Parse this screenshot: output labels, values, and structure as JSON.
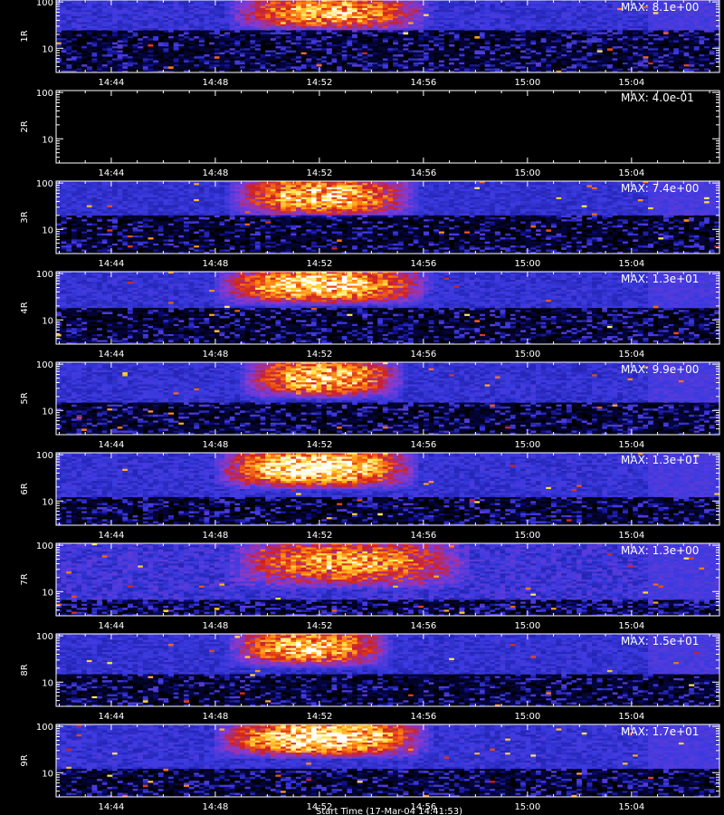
{
  "chart_data": {
    "type": "heatmap",
    "xlabel": "Start Time (17-Mar-04 14:41:53)",
    "x_ticks": [
      "14:44",
      "14:48",
      "14:52",
      "14:56",
      "15:00",
      "15:04"
    ],
    "x_tick_minutes_after_start": [
      2.12,
      6.12,
      10.12,
      14.12,
      18.12,
      22.12
    ],
    "x_range_minutes": [
      0,
      25.5
    ],
    "y_scale": "log",
    "y_ticks": [
      "100",
      "10"
    ],
    "y_tick_values": [
      100,
      10
    ],
    "y_range": [
      3,
      110
    ],
    "colormap": [
      "#000000",
      "#0a0a80",
      "#3a3ae0",
      "#8a3ad0",
      "#d02020",
      "#ff7a10",
      "#ffe040",
      "#ffffff"
    ],
    "panels": [
      {
        "label": "1R",
        "max_text": "MAX: 8.1e+00",
        "max": 8.1,
        "band": [
          40,
          90
        ],
        "burst": [
          6.5,
          14.5
        ],
        "burst_peak": 0.75,
        "threshold": 25,
        "noise": 0.55
      },
      {
        "label": "2R",
        "max_text": "MAX: 4.0e-01",
        "max": 0.4,
        "band": [
          40,
          90
        ],
        "burst": [
          6.5,
          14.5
        ],
        "burst_peak": 0,
        "threshold": 25,
        "noise": 0
      },
      {
        "label": "3R",
        "max_text": "MAX: 7.4e+00",
        "max": 7.4,
        "band": [
          30,
          90
        ],
        "burst": [
          6.5,
          14.0
        ],
        "burst_peak": 0.8,
        "threshold": 20,
        "noise": 0.45
      },
      {
        "label": "4R",
        "max_text": "MAX: 1.3e+01",
        "max": 13,
        "band": [
          35,
          95
        ],
        "burst": [
          6.0,
          14.5
        ],
        "burst_peak": 0.9,
        "threshold": 18,
        "noise": 0.5
      },
      {
        "label": "5R",
        "max_text": "MAX: 9.9e+00",
        "max": 9.9,
        "band": [
          30,
          95
        ],
        "burst": [
          7.0,
          13.5
        ],
        "burst_peak": 0.8,
        "threshold": 15,
        "noise": 0.5
      },
      {
        "label": "6R",
        "max_text": "MAX: 1.3e+01",
        "max": 13,
        "band": [
          30,
          95
        ],
        "burst": [
          6.0,
          14.0
        ],
        "burst_peak": 0.95,
        "threshold": 12,
        "noise": 0.55
      },
      {
        "label": "7R",
        "max_text": "MAX: 1.3e+00",
        "max": 1.3,
        "band": [
          20,
          90
        ],
        "burst": [
          6.5,
          16.0
        ],
        "burst_peak": 0.65,
        "threshold": 7,
        "noise": 0.75
      },
      {
        "label": "8R",
        "max_text": "MAX: 1.5e+01",
        "max": 15,
        "band": [
          35,
          95
        ],
        "burst": [
          6.5,
          13.0
        ],
        "burst_peak": 0.8,
        "threshold": 15,
        "noise": 0.5
      },
      {
        "label": "9R",
        "max_text": "MAX: 1.7e+01",
        "max": 17,
        "band": [
          35,
          95
        ],
        "burst": [
          6.0,
          14.5
        ],
        "burst_peak": 0.95,
        "threshold": 12,
        "noise": 0.55
      }
    ]
  }
}
